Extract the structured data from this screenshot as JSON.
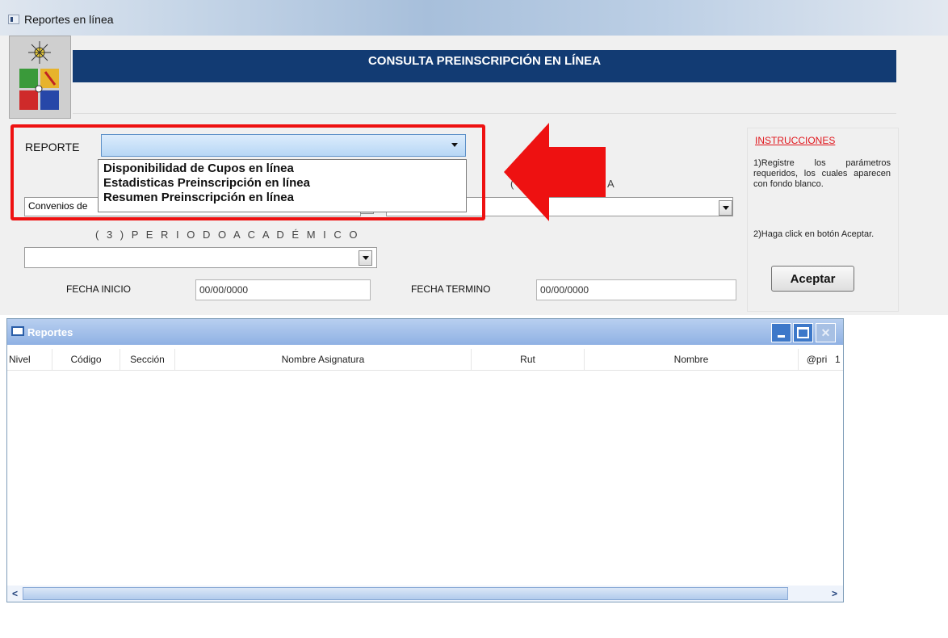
{
  "window": {
    "title": "Reportes en línea"
  },
  "header": {
    "title": "CONSULTA PREINSCRIPCIÓN  EN LÍNEA"
  },
  "form": {
    "reporte_label": "REPORTE",
    "reporte_options": [
      "Disponibilidad de Cupos en línea",
      "Estadisticas Preinscripción en línea",
      "Resumen Preinscripción en línea"
    ],
    "field2_value": "Convenios de",
    "obscured_label_fragment": "(",
    "obscured_label_tail": "A",
    "periodo_label": "( 3 )  P E R I O D O   A C A D É M I C O",
    "periodo_value": "",
    "fecha_inicio_label": "FECHA INICIO",
    "fecha_inicio_value": "00/00/0000",
    "fecha_termino_label": "FECHA TERMINO",
    "fecha_termino_value": "00/00/0000"
  },
  "instructions": {
    "title": "INSTRUCCIONES",
    "step1": "1)Registre los parámetros requeridos, los cuales aparecen con fondo blanco.",
    "step2": "2)Haga click en botón Aceptar.",
    "accept_label": "Aceptar"
  },
  "reportes": {
    "title": "Reportes",
    "columns": [
      "Nivel",
      "Código",
      "Sección",
      "Nombre Asignatura",
      "Rut",
      "Nombre",
      "@pri",
      "1"
    ]
  },
  "colors": {
    "banner": "#123b73",
    "highlight": "#ee1111",
    "instructions_title": "#e0161c"
  },
  "icons": [
    "app-window-icon",
    "university-logo",
    "red-arrow-icon",
    "chevron-down-icon",
    "minimize-icon",
    "maximize-icon",
    "close-icon",
    "scroll-left-icon",
    "scroll-right-icon"
  ]
}
